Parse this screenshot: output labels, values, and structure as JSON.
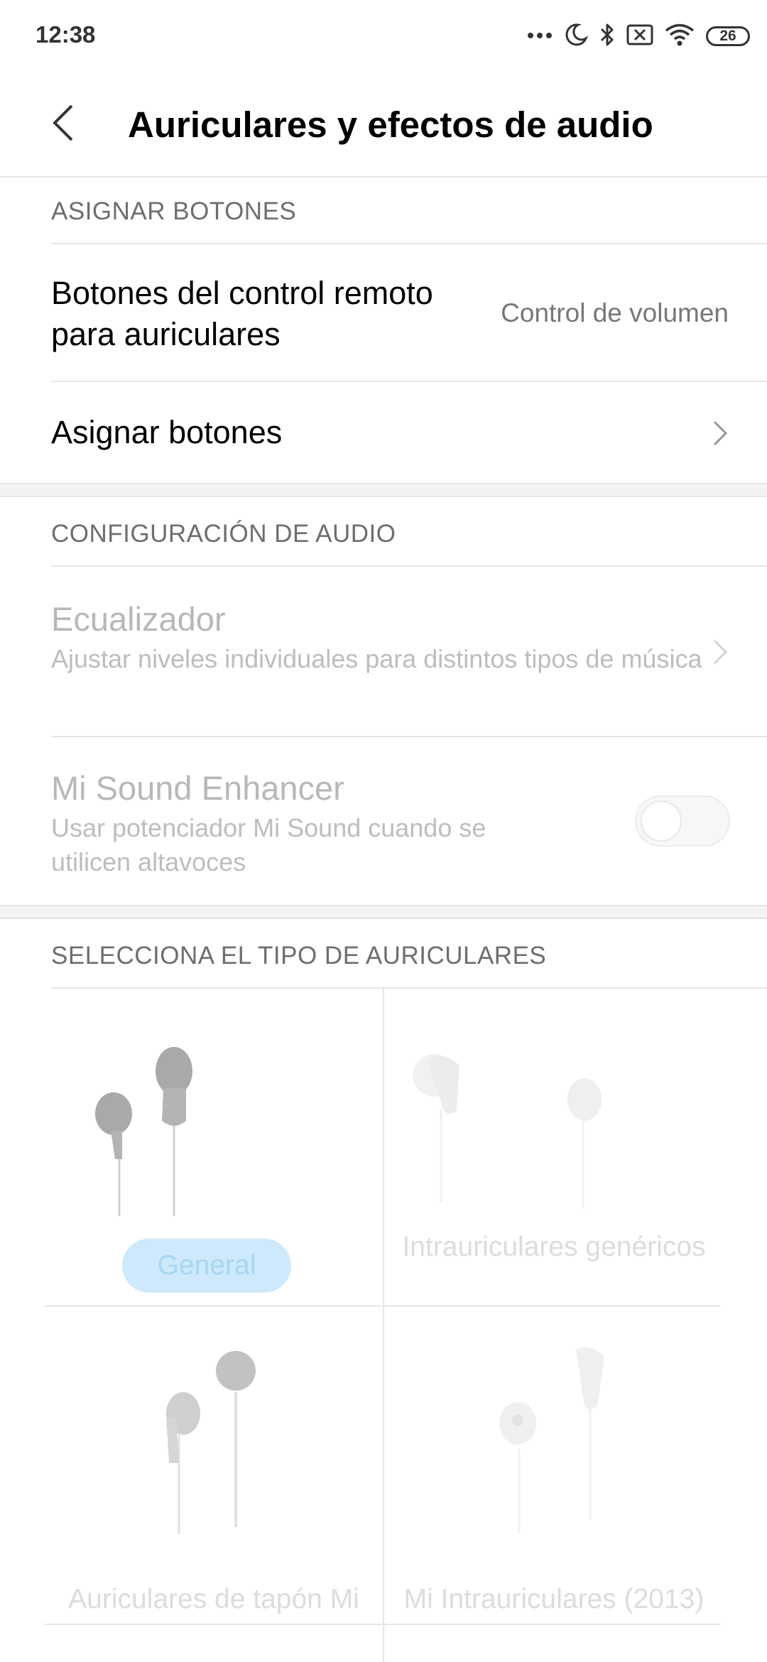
{
  "status_bar": {
    "time": "12:38",
    "battery": "26",
    "icons": [
      "more-dots-icon",
      "moon-icon",
      "bluetooth-icon",
      "sim-off-icon",
      "wifi-icon",
      "battery-icon"
    ]
  },
  "header": {
    "title": "Auriculares y efectos de audio",
    "back_icon": "chevron-left-icon"
  },
  "assign_section": {
    "header": "ASIGNAR BOTONES",
    "remote_title": "Botones del control remoto para auriculares",
    "remote_value": "Control de volumen",
    "assign_label": "Asignar botones"
  },
  "audio_section": {
    "header": "CONFIGURACIÓN DE AUDIO",
    "eq_title": "Ecualizador",
    "eq_subtitle": "Ajustar niveles individuales para distintos tipos de música",
    "enhancer_title": "Mi Sound Enhancer",
    "enhancer_subtitle": "Usar potenciador Mi Sound cuando se utilicen altavoces",
    "enhancer_enabled": false
  },
  "earphones_section": {
    "header": "SELECCIONA EL TIPO DE AURICULARES",
    "types": [
      {
        "label": "General",
        "selected": true
      },
      {
        "label": "Intrauriculares genéricos",
        "selected": false
      },
      {
        "label": "Auriculares de tapón Mi",
        "selected": false
      },
      {
        "label": "Mi Intrauriculares (2013)",
        "selected": false
      }
    ]
  },
  "colors": {
    "selected_pill": "#cde9fb",
    "disabled_text": "#b8b8b8",
    "divider": "#e6e6e6"
  }
}
